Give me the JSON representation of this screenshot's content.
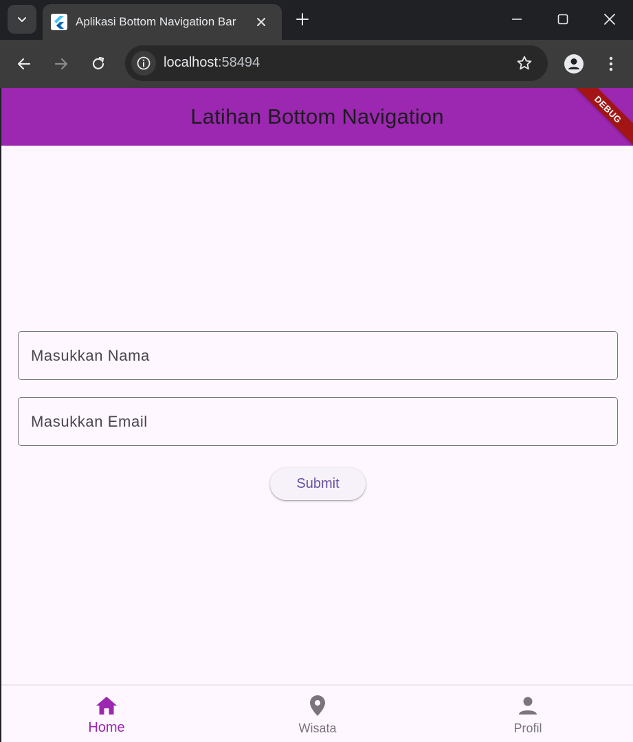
{
  "browser": {
    "tab": {
      "title": "Aplikasi Bottom Navigation Bar"
    },
    "address": {
      "host": "localhost",
      "port": ":58494"
    }
  },
  "app": {
    "appbar": {
      "title": "Latihan Bottom Navigation"
    },
    "debug_banner": "DEBUG",
    "form": {
      "name_placeholder": "Masukkan Nama",
      "email_placeholder": "Masukkan Email",
      "submit_label": "Submit"
    },
    "bottom_nav": {
      "items": [
        {
          "label": "Home",
          "icon": "home-icon",
          "active": true
        },
        {
          "label": "Wisata",
          "icon": "location-pin-icon",
          "active": false
        },
        {
          "label": "Profil",
          "icon": "person-icon",
          "active": false
        }
      ]
    }
  },
  "colors": {
    "appbar": "#9c27b0",
    "accent": "#9c27b0",
    "inactive": "#79747e",
    "background": "#fef7ff",
    "button_text": "#6750a4"
  }
}
